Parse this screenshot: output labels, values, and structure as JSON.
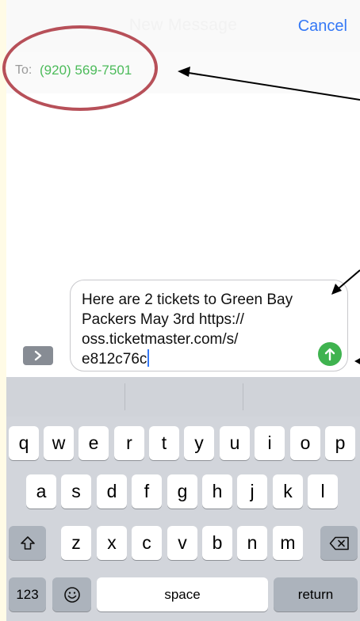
{
  "nav": {
    "title": "New Message",
    "cancel_label": "Cancel"
  },
  "recipient": {
    "to_label": "To:",
    "phone": "(920) 569-7501"
  },
  "compose": {
    "lines": [
      "Here are 2 tickets to Green Bay",
      "Packers May 3rd https://",
      "oss.ticketmaster.com/s/",
      "e812c76c"
    ]
  },
  "keyboard": {
    "row1": [
      "q",
      "w",
      "e",
      "r",
      "t",
      "y",
      "u",
      "i",
      "o",
      "p"
    ],
    "row2": [
      "a",
      "s",
      "d",
      "f",
      "g",
      "h",
      "j",
      "k",
      "l"
    ],
    "row3": [
      "z",
      "x",
      "c",
      "v",
      "b",
      "n",
      "m"
    ],
    "numbers_label": "123",
    "space_label": "space",
    "return_label": "return"
  },
  "colors": {
    "accent": "#3478f6",
    "recipient_green": "#4cbb5a",
    "send_green": "#3fb34f",
    "annotation_circle": "#b75059"
  },
  "icons": {
    "send": "arrow-up-icon",
    "apps": "chevron-right-icon",
    "shift": "shift-icon",
    "delete": "backspace-icon",
    "emoji": "emoji-icon"
  }
}
